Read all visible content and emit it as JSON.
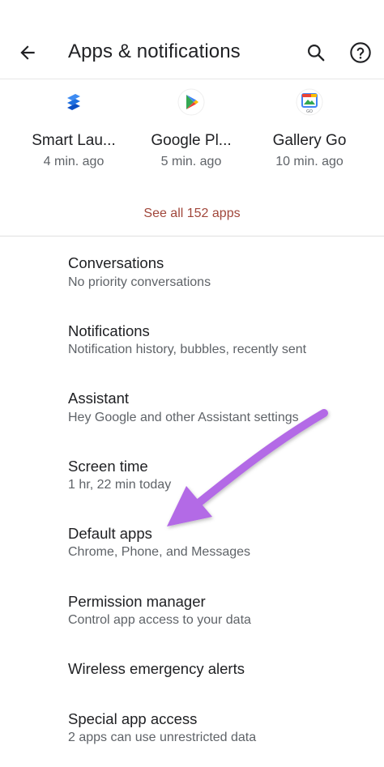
{
  "header": {
    "title": "Apps & notifications",
    "back_icon": "arrow-left-icon",
    "search_icon": "search-icon",
    "help_icon": "help-circle-icon"
  },
  "recent_apps": [
    {
      "name": "Smart Lau...",
      "time": "4 min. ago",
      "icon": "smart-launcher-icon"
    },
    {
      "name": "Google Pl...",
      "time": "5 min. ago",
      "icon": "google-play-icon"
    },
    {
      "name": "Gallery Go",
      "time": "10 min. ago",
      "icon": "gallery-go-icon"
    }
  ],
  "see_all": "See all 152 apps",
  "settings": [
    {
      "title": "Conversations",
      "summary": "No priority conversations"
    },
    {
      "title": "Notifications",
      "summary": "Notification history, bubbles, recently sent"
    },
    {
      "title": "Assistant",
      "summary": "Hey Google and other Assistant settings"
    },
    {
      "title": "Screen time",
      "summary": "1 hr, 22 min today"
    },
    {
      "title": "Default apps",
      "summary": "Chrome, Phone, and Messages"
    },
    {
      "title": "Permission manager",
      "summary": "Control app access to your data"
    },
    {
      "title": "Wireless emergency alerts"
    },
    {
      "title": "Special app access",
      "summary": "2 apps can use unrestricted data"
    }
  ],
  "colors": {
    "accent_link": "#a1473b",
    "annotation_arrow": "#b36ae6"
  }
}
